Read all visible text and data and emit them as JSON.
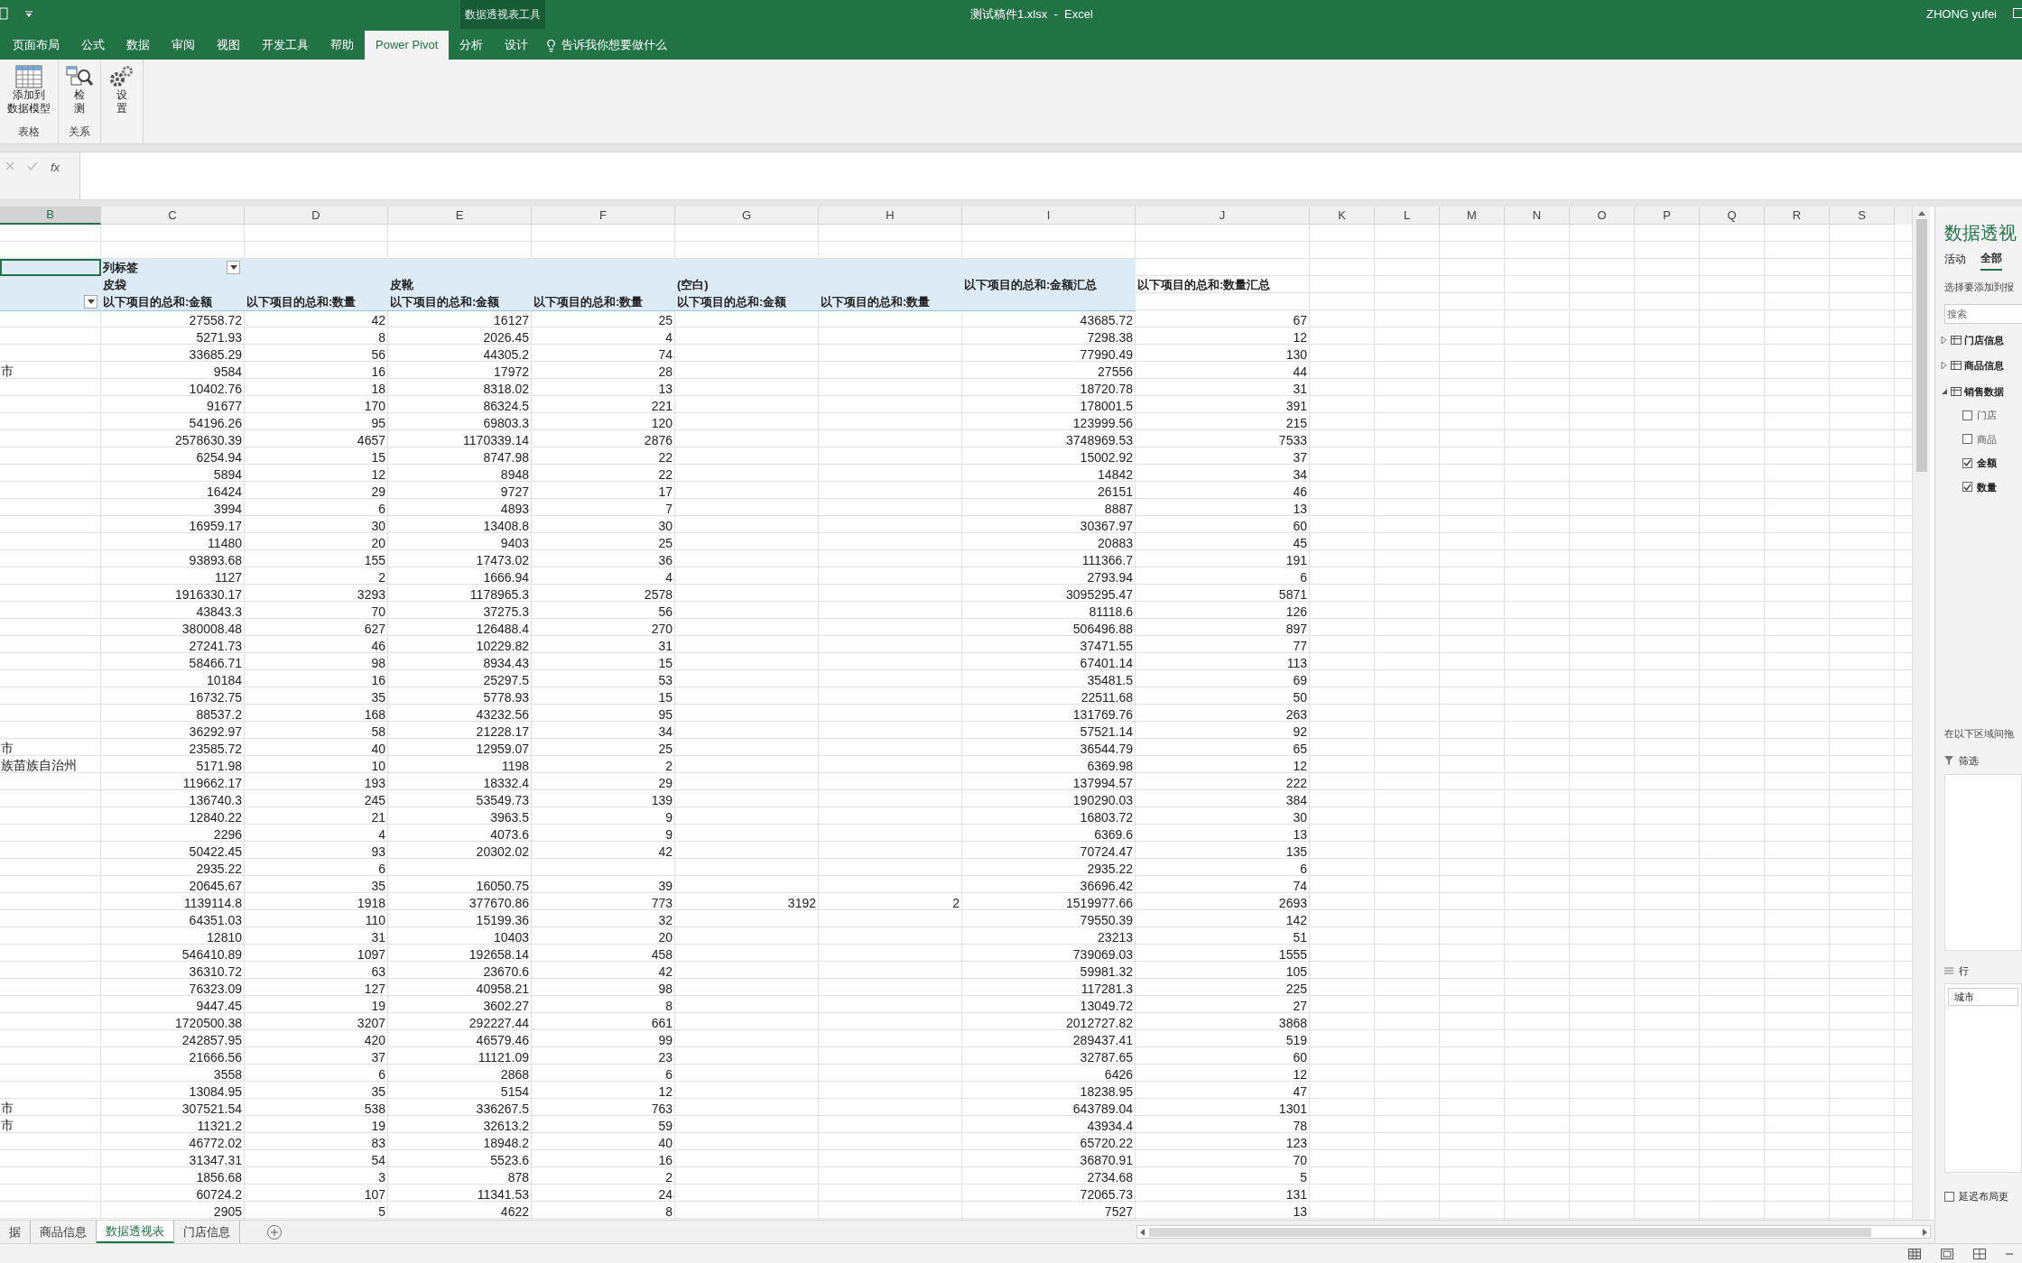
{
  "title_bar": {
    "context_label": "数据透视表工具",
    "title": "测试稿件1.xlsx  -  Excel",
    "user": "ZHONG yufei"
  },
  "ribbon_tabs": [
    {
      "label": "页面布局",
      "selected": false
    },
    {
      "label": "公式",
      "selected": false
    },
    {
      "label": "数据",
      "selected": false
    },
    {
      "label": "审阅",
      "selected": false
    },
    {
      "label": "视图",
      "selected": false
    },
    {
      "label": "开发工具",
      "selected": false
    },
    {
      "label": "帮助",
      "selected": false
    },
    {
      "label": "Power Pivot",
      "selected": true
    },
    {
      "label": "分析",
      "selected": false
    },
    {
      "label": "设计",
      "selected": false
    }
  ],
  "tell_me": "告诉我你想要做什么",
  "ribbon_groups": [
    {
      "label": "表格",
      "buttons": [
        {
          "kind": "table",
          "lines": [
            "添加到",
            "数据模型"
          ]
        }
      ]
    },
    {
      "label": "关系",
      "buttons": [
        {
          "kind": "detect",
          "lines": [
            "检",
            "测"
          ]
        }
      ]
    },
    {
      "buttons": [
        {
          "kind": "gear",
          "lines": [
            "设",
            "置"
          ]
        }
      ]
    }
  ],
  "formula_bar": {
    "function_label": "fx"
  },
  "columns": [
    {
      "label": "B",
      "selected": true
    },
    {
      "label": "C",
      "selected": false
    },
    {
      "label": "D",
      "selected": false
    },
    {
      "label": "E",
      "selected": false
    },
    {
      "label": "F",
      "selected": false
    },
    {
      "label": "G",
      "selected": false
    },
    {
      "label": "H",
      "selected": false
    },
    {
      "label": "I",
      "selected": false
    },
    {
      "label": "J",
      "selected": false
    },
    {
      "label": "K",
      "selected": false
    },
    {
      "label": "L",
      "selected": false
    },
    {
      "label": "M",
      "selected": false
    },
    {
      "label": "N",
      "selected": false
    },
    {
      "label": "O",
      "selected": false
    },
    {
      "label": "P",
      "selected": false
    },
    {
      "label": "Q",
      "selected": false
    },
    {
      "label": "R",
      "selected": false
    },
    {
      "label": "S",
      "selected": false
    }
  ],
  "pivot_header": {
    "column_labels": "列标签",
    "group_row": {
      "C": "皮袋",
      "E": "皮靴",
      "G": "(空白)",
      "I": "以下项目的总和:金额汇总",
      "J": "以下项目的总和:数量汇总"
    },
    "field_row": {
      "C": "以下项目的总和:金额",
      "D": "以下项目的总和:数量",
      "E": "以下项目的总和:金额",
      "F": "以下项目的总和:数量",
      "G": "以下项目的总和:金额",
      "H": "以下项目的总和:数量"
    }
  },
  "rows": [
    {
      "C": "27558.72",
      "D": "42",
      "E": "16127",
      "F": "25",
      "I": "43685.72",
      "J": "67"
    },
    {
      "C": "5271.93",
      "D": "8",
      "E": "2026.45",
      "F": "4",
      "I": "7298.38",
      "J": "12"
    },
    {
      "C": "33685.29",
      "D": "56",
      "E": "44305.2",
      "F": "74",
      "I": "77990.49",
      "J": "130"
    },
    {
      "B": "市",
      "C": "9584",
      "D": "16",
      "E": "17972",
      "F": "28",
      "I": "27556",
      "J": "44"
    },
    {
      "C": "10402.76",
      "D": "18",
      "E": "8318.02",
      "F": "13",
      "I": "18720.78",
      "J": "31"
    },
    {
      "C": "91677",
      "D": "170",
      "E": "86324.5",
      "F": "221",
      "I": "178001.5",
      "J": "391"
    },
    {
      "C": "54196.26",
      "D": "95",
      "E": "69803.3",
      "F": "120",
      "I": "123999.56",
      "J": "215"
    },
    {
      "C": "2578630.39",
      "D": "4657",
      "E": "1170339.14",
      "F": "2876",
      "I": "3748969.53",
      "J": "7533"
    },
    {
      "C": "6254.94",
      "D": "15",
      "E": "8747.98",
      "F": "22",
      "I": "15002.92",
      "J": "37"
    },
    {
      "C": "5894",
      "D": "12",
      "E": "8948",
      "F": "22",
      "I": "14842",
      "J": "34"
    },
    {
      "C": "16424",
      "D": "29",
      "E": "9727",
      "F": "17",
      "I": "26151",
      "J": "46"
    },
    {
      "C": "3994",
      "D": "6",
      "E": "4893",
      "F": "7",
      "I": "8887",
      "J": "13"
    },
    {
      "C": "16959.17",
      "D": "30",
      "E": "13408.8",
      "F": "30",
      "I": "30367.97",
      "J": "60"
    },
    {
      "C": "11480",
      "D": "20",
      "E": "9403",
      "F": "25",
      "I": "20883",
      "J": "45"
    },
    {
      "C": "93893.68",
      "D": "155",
      "E": "17473.02",
      "F": "36",
      "I": "111366.7",
      "J": "191"
    },
    {
      "C": "1127",
      "D": "2",
      "E": "1666.94",
      "F": "4",
      "I": "2793.94",
      "J": "6"
    },
    {
      "C": "1916330.17",
      "D": "3293",
      "E": "1178965.3",
      "F": "2578",
      "I": "3095295.47",
      "J": "5871"
    },
    {
      "C": "43843.3",
      "D": "70",
      "E": "37275.3",
      "F": "56",
      "I": "81118.6",
      "J": "126"
    },
    {
      "C": "380008.48",
      "D": "627",
      "E": "126488.4",
      "F": "270",
      "I": "506496.88",
      "J": "897"
    },
    {
      "C": "27241.73",
      "D": "46",
      "E": "10229.82",
      "F": "31",
      "I": "37471.55",
      "J": "77"
    },
    {
      "C": "58466.71",
      "D": "98",
      "E": "8934.43",
      "F": "15",
      "I": "67401.14",
      "J": "113"
    },
    {
      "C": "10184",
      "D": "16",
      "E": "25297.5",
      "F": "53",
      "I": "35481.5",
      "J": "69"
    },
    {
      "C": "16732.75",
      "D": "35",
      "E": "5778.93",
      "F": "15",
      "I": "22511.68",
      "J": "50"
    },
    {
      "C": "88537.2",
      "D": "168",
      "E": "43232.56",
      "F": "95",
      "I": "131769.76",
      "J": "263"
    },
    {
      "C": "36292.97",
      "D": "58",
      "E": "21228.17",
      "F": "34",
      "I": "57521.14",
      "J": "92"
    },
    {
      "B": "市",
      "C": "23585.72",
      "D": "40",
      "E": "12959.07",
      "F": "25",
      "I": "36544.79",
      "J": "65"
    },
    {
      "B": "族苗族自治州",
      "C": "5171.98",
      "D": "10",
      "E": "1198",
      "F": "2",
      "I": "6369.98",
      "J": "12"
    },
    {
      "C": "119662.17",
      "D": "193",
      "E": "18332.4",
      "F": "29",
      "I": "137994.57",
      "J": "222"
    },
    {
      "C": "136740.3",
      "D": "245",
      "E": "53549.73",
      "F": "139",
      "I": "190290.03",
      "J": "384"
    },
    {
      "C": "12840.22",
      "D": "21",
      "E": "3963.5",
      "F": "9",
      "I": "16803.72",
      "J": "30"
    },
    {
      "C": "2296",
      "D": "4",
      "E": "4073.6",
      "F": "9",
      "I": "6369.6",
      "J": "13"
    },
    {
      "C": "50422.45",
      "D": "93",
      "E": "20302.02",
      "F": "42",
      "I": "70724.47",
      "J": "135"
    },
    {
      "C": "2935.22",
      "D": "6",
      "I": "2935.22",
      "J": "6"
    },
    {
      "C": "20645.67",
      "D": "35",
      "E": "16050.75",
      "F": "39",
      "I": "36696.42",
      "J": "74"
    },
    {
      "C": "1139114.8",
      "D": "1918",
      "E": "377670.86",
      "F": "773",
      "G": "3192",
      "H": "2",
      "I": "1519977.66",
      "J": "2693"
    },
    {
      "C": "64351.03",
      "D": "110",
      "E": "15199.36",
      "F": "32",
      "I": "79550.39",
      "J": "142"
    },
    {
      "C": "12810",
      "D": "31",
      "E": "10403",
      "F": "20",
      "I": "23213",
      "J": "51"
    },
    {
      "C": "546410.89",
      "D": "1097",
      "E": "192658.14",
      "F": "458",
      "I": "739069.03",
      "J": "1555"
    },
    {
      "C": "36310.72",
      "D": "63",
      "E": "23670.6",
      "F": "42",
      "I": "59981.32",
      "J": "105"
    },
    {
      "C": "76323.09",
      "D": "127",
      "E": "40958.21",
      "F": "98",
      "I": "117281.3",
      "J": "225"
    },
    {
      "C": "9447.45",
      "D": "19",
      "E": "3602.27",
      "F": "8",
      "I": "13049.72",
      "J": "27"
    },
    {
      "C": "1720500.38",
      "D": "3207",
      "E": "292227.44",
      "F": "661",
      "I": "2012727.82",
      "J": "3868"
    },
    {
      "C": "242857.95",
      "D": "420",
      "E": "46579.46",
      "F": "99",
      "I": "289437.41",
      "J": "519"
    },
    {
      "C": "21666.56",
      "D": "37",
      "E": "11121.09",
      "F": "23",
      "I": "32787.65",
      "J": "60"
    },
    {
      "C": "3558",
      "D": "6",
      "E": "2868",
      "F": "6",
      "I": "6426",
      "J": "12"
    },
    {
      "C": "13084.95",
      "D": "35",
      "E": "5154",
      "F": "12",
      "I": "18238.95",
      "J": "47"
    },
    {
      "B": "市",
      "C": "307521.54",
      "D": "538",
      "E": "336267.5",
      "F": "763",
      "I": "643789.04",
      "J": "1301"
    },
    {
      "B": "市",
      "C": "11321.2",
      "D": "19",
      "E": "32613.2",
      "F": "59",
      "I": "43934.4",
      "J": "78"
    },
    {
      "C": "46772.02",
      "D": "83",
      "E": "18948.2",
      "F": "40",
      "I": "65720.22",
      "J": "123"
    },
    {
      "C": "31347.31",
      "D": "54",
      "E": "5523.6",
      "F": "16",
      "I": "36870.91",
      "J": "70"
    },
    {
      "C": "1856.68",
      "D": "3",
      "E": "878",
      "F": "2",
      "I": "2734.68",
      "J": "5"
    },
    {
      "C": "60724.2",
      "D": "107",
      "E": "11341.53",
      "F": "24",
      "I": "72065.73",
      "J": "131"
    },
    {
      "C": "2905",
      "D": "5",
      "E": "4622",
      "F": "8",
      "I": "7527",
      "J": "13"
    }
  ],
  "sheet_tabs": [
    {
      "label": "据",
      "selected": false
    },
    {
      "label": "商品信息",
      "selected": false
    },
    {
      "label": "数据透视表",
      "selected": true
    },
    {
      "label": "门店信息",
      "selected": false
    }
  ],
  "pivot_panel": {
    "title": "数据透视",
    "tabs": [
      {
        "label": "活动",
        "selected": false
      },
      {
        "label": "全部",
        "selected": true
      }
    ],
    "hint": "选择要添加到报",
    "search_placeholder": "搜索",
    "tables": [
      {
        "label": "门店信息",
        "expanded": false
      },
      {
        "label": "商品信息",
        "expanded": false
      },
      {
        "label": "销售数据",
        "expanded": true,
        "children": [
          {
            "label": "门店",
            "checked": false
          },
          {
            "label": "商品",
            "checked": false
          },
          {
            "label": "金额",
            "checked": true
          },
          {
            "label": "数量",
            "checked": true
          }
        ]
      }
    ],
    "areas_hint": "在以下区域间拖",
    "filter_label": "筛选",
    "rows_label": "行",
    "row_fields": [
      "城市"
    ],
    "defer_label": "延迟布局更",
    "defer_checked": false
  }
}
